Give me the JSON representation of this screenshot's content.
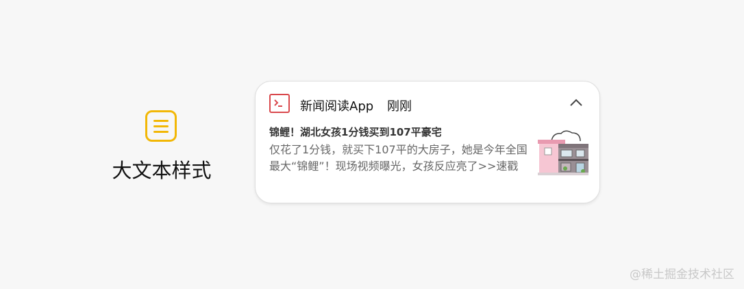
{
  "style": {
    "label": "大文本样式",
    "icon": "text-lines-icon",
    "accent": "#f2b705"
  },
  "notification": {
    "app_name": "新闻阅读App",
    "time": "刚刚",
    "title": "锦鲤！湖北女孩1分钱买到107平豪宅",
    "body": "仅花了1分钱，就买下107平的大房子，她是今年全国最大“锦鲤”！现场视频曝光，女孩反应亮了>>速戳",
    "app_icon": "terminal-icon",
    "app_icon_color": "#d9474b",
    "collapse_icon": "chevron-up-icon",
    "thumbnail": "house-image"
  },
  "watermark": "@稀土掘金技术社区"
}
